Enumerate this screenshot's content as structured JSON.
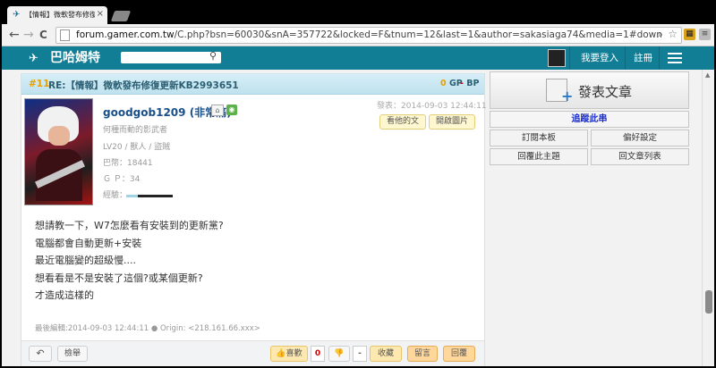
{
  "browser": {
    "tab_title": "【情報】微軟發布修復更新",
    "url_host": "forum.gamer.com.tw",
    "url_path": "/C.php?bsn=60030&snA=357722&locked=F&tnum=12&last=1&author=sakasiaga74&media=1#down",
    "back": "←",
    "forward": "→",
    "reload": "C",
    "close": "×"
  },
  "site": {
    "logo": "巴哈姆特",
    "login": "我要登入",
    "register": "註冊"
  },
  "post": {
    "floor": "#11",
    "subject": "RE:【情報】微軟發布修復更新KB2993651",
    "gp_count": "0",
    "gp_label": "GP",
    "bp_label": "BP",
    "username": "goodgob1209",
    "nickname": "(非常痛)",
    "title_line": "何種而動的影武者",
    "level_line": "LV20 / 獸人 / 盜賊",
    "coins": "巴幣：18441",
    "gp_line": "Ｇ Ｐ：34",
    "exp_label": "經驗：",
    "exp_fraction": 0.25,
    "post_time": "發表：2014-09-03 12:44:11",
    "view_posts": "看他的文",
    "open_images": "開啟圖片",
    "body": [
      "想請教一下，W7怎麼看有安裝到的更新黨?",
      "電腦都會自動更新+安裝",
      "最近電腦變的超級慢....",
      "想看看是不是安裝了這個?或某個更新?",
      "才造成這樣的"
    ],
    "last_edit": "最後編輯:2014-09-03 12:44:11 ● Origin: <218.161.66.xxx>",
    "report": "檢舉",
    "like": "喜歡",
    "like_count": "0",
    "dislike_count": "-",
    "collect": "收藏",
    "comment": "留言",
    "reply": "回覆"
  },
  "sidebar": {
    "publish": "發表文章",
    "track": "追蹤此串",
    "subscribe": "訂閱本板",
    "preferences": "偏好設定",
    "back_to_topic": "回覆此主題",
    "back_to_list": "回文章列表"
  }
}
